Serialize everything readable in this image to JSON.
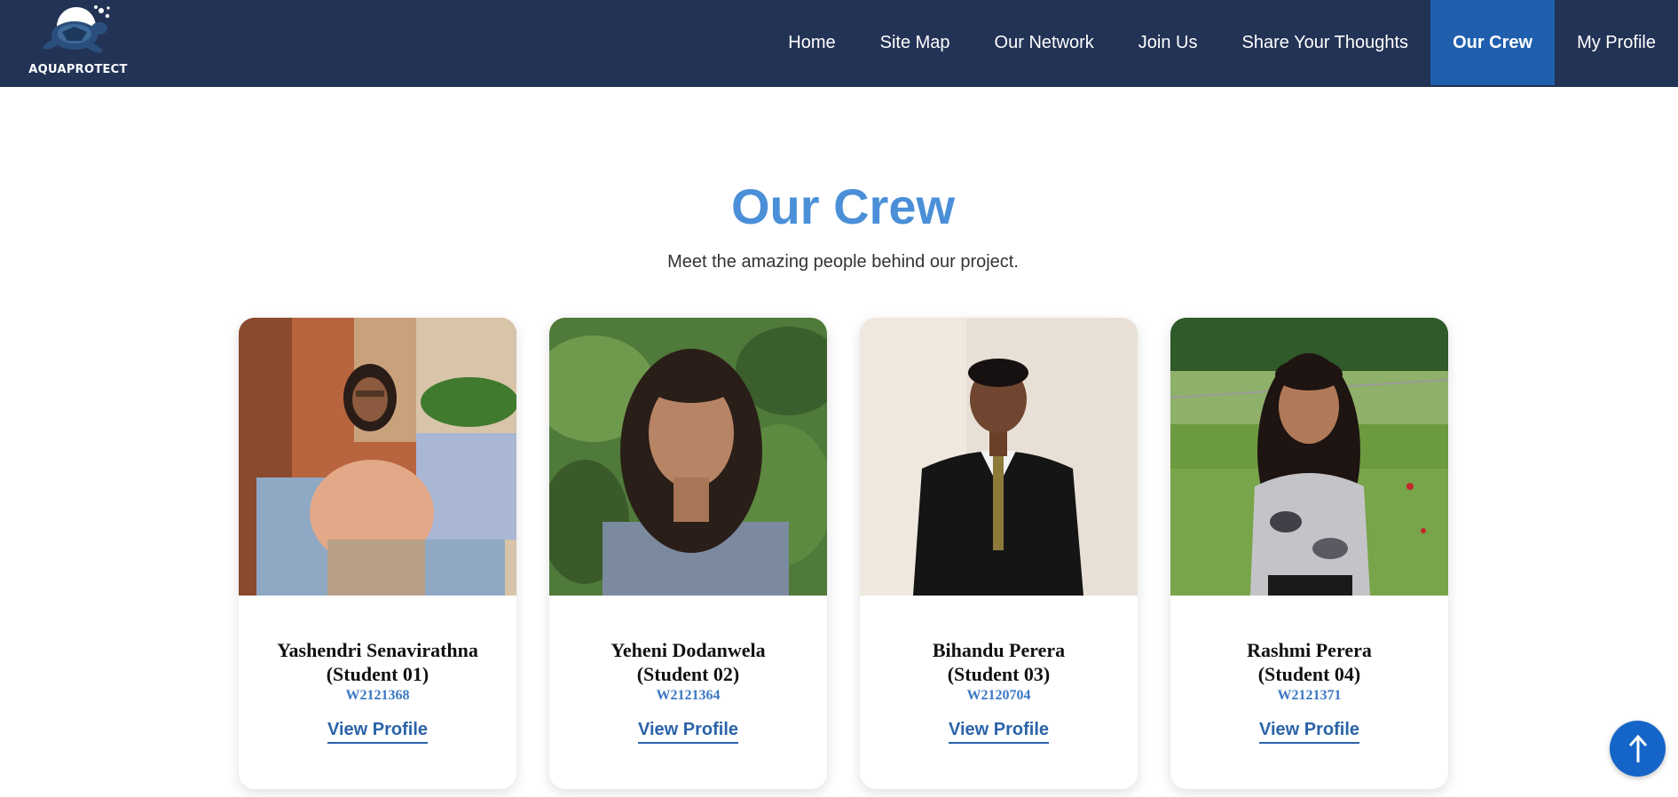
{
  "brand": {
    "name": "AQUAPROTECT",
    "logo_icon": "turtle-icon"
  },
  "nav": {
    "items": [
      {
        "label": "Home",
        "active": false
      },
      {
        "label": "Site Map",
        "active": false
      },
      {
        "label": "Our Network",
        "active": false
      },
      {
        "label": "Join Us",
        "active": false
      },
      {
        "label": "Share Your Thoughts",
        "active": false
      },
      {
        "label": "Our Crew",
        "active": true
      },
      {
        "label": "My Profile",
        "active": false
      }
    ]
  },
  "main": {
    "title": "Our Crew",
    "subtitle": "Meet the amazing people behind our project."
  },
  "crew": [
    {
      "name": "Yashendri Senavirathna",
      "role": "(Student 01)",
      "id": "W2121368",
      "link": "View Profile"
    },
    {
      "name": "Yeheni Dodanwela",
      "role": "(Student 02)",
      "id": "W2121364",
      "link": "View Profile"
    },
    {
      "name": "Bihandu Perera",
      "role": "(Student 03)",
      "id": "W2120704",
      "link": "View Profile"
    },
    {
      "name": "Rashmi Perera",
      "role": "(Student 04)",
      "id": "W2121371",
      "link": "View Profile"
    }
  ],
  "scroll_top": {
    "icon": "arrow-up-icon"
  },
  "colors": {
    "header_bg": "#223355",
    "active_nav": "#1f5fae",
    "title": "#4a8fd8",
    "link": "#2a63a8",
    "button": "#1565c8"
  }
}
